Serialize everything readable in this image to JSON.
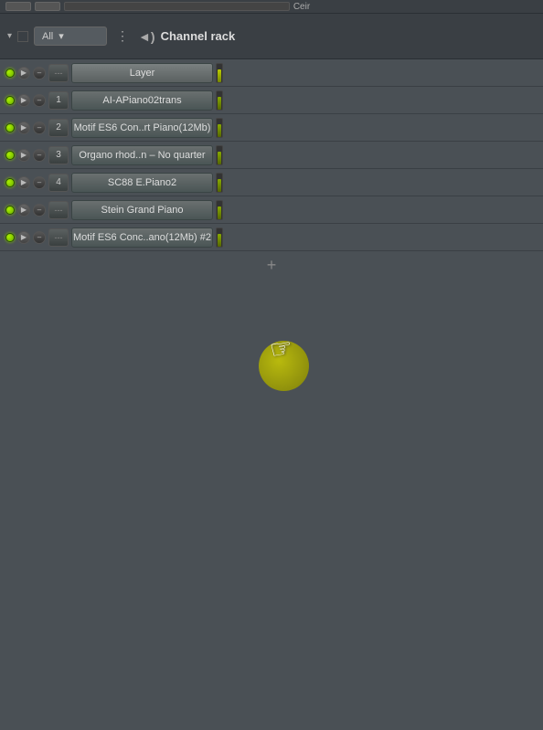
{
  "topbar": {
    "dropdown_label": "All",
    "dropdown_arrow": "▾",
    "menu_dots": "⋮",
    "title": "Channel rack",
    "speaker_icon": "◄)",
    "all_label": "All"
  },
  "channels": [
    {
      "id": 0,
      "num": "",
      "num_type": "dashes",
      "name": "Layer",
      "is_layer": true,
      "led_active": true
    },
    {
      "id": 1,
      "num": "1",
      "num_type": "number",
      "name": "AI-APiano02trans",
      "is_layer": false,
      "led_active": true
    },
    {
      "id": 2,
      "num": "2",
      "num_type": "number",
      "name": "Motif ES6 Con..rt Piano(12Mb)",
      "is_layer": false,
      "led_active": true
    },
    {
      "id": 3,
      "num": "3",
      "num_type": "number",
      "name": "Organo rhod..n – No quarter",
      "is_layer": false,
      "led_active": true
    },
    {
      "id": 4,
      "num": "4",
      "num_type": "number",
      "name": "SC88 E.Piano2",
      "is_layer": false,
      "led_active": true
    },
    {
      "id": 5,
      "num": "---",
      "num_type": "dashes",
      "name": "Stein Grand Piano",
      "is_layer": false,
      "led_active": true
    },
    {
      "id": 6,
      "num": "---",
      "num_type": "dashes",
      "name": "Motif ES6 Conc..ano(12Mb) #2",
      "is_layer": false,
      "led_active": true
    }
  ],
  "add_button": "+",
  "stub": {
    "label": "Ceir"
  }
}
